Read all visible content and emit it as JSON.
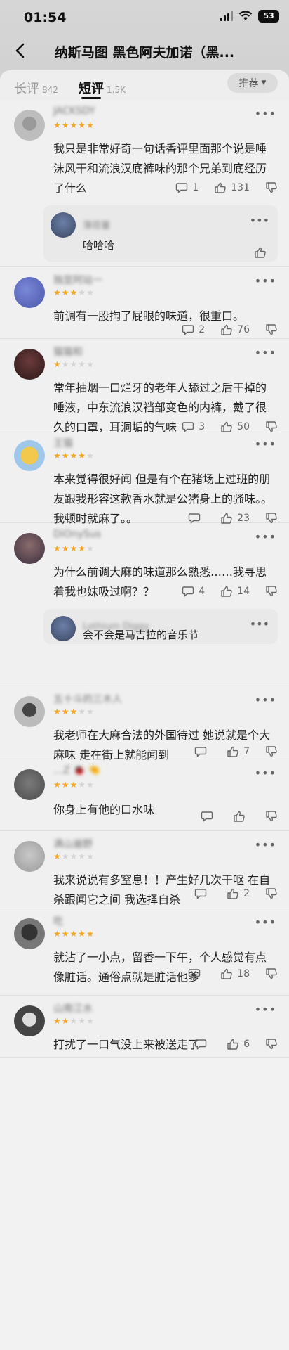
{
  "status_bar": {
    "time": "01:54",
    "battery": "53"
  },
  "nav": {
    "title": "纳斯马图 黑色阿夫加诺（黑..."
  },
  "tabs": {
    "long": {
      "label": "长评",
      "count": "842"
    },
    "short": {
      "label": "短评",
      "count": "1.5K"
    },
    "sort_label": "推荐"
  },
  "colors": {
    "star_on": "#f5a623",
    "star_off": "#d4d4d4",
    "background": "#f0f0f0"
  },
  "comments": [
    {
      "username": "JACKSDY",
      "rating": 5,
      "text": "我只是非常好奇一句话香评里面那个说是唾沫风干和流浪汉底裤味的那个兄弟到底经历了什么",
      "replies_count": "1",
      "likes": "131",
      "reply": {
        "username": "薄荷薯",
        "text": "哈哈哈"
      }
    },
    {
      "username": "独显阿站一",
      "rating": 3,
      "text": "前调有一股掏了屁眼的味道，很重口。",
      "replies_count": "2",
      "likes": "76"
    },
    {
      "username": "猫猫和",
      "rating": 1,
      "text": "常年抽烟一口烂牙的老年人舔过之后干掉的唾液，中东流浪汉裆部变色的内裤，戴了很久的口罩，耳洞垢的气味",
      "replies_count": "3",
      "likes": "50"
    },
    {
      "username": "王猫",
      "rating": 4,
      "text": "本来觉得很好闻 但是有个在猪场上过班的朋友跟我形容这款香水就是公猪身上的骚味。。我顿时就麻了。。",
      "replies_count": "",
      "likes": "23"
    },
    {
      "username": "DiOnySus",
      "rating": 4,
      "text": "为什么前调大麻的味道那么熟悉……我寻思着我也妹吸过啊？？",
      "replies_count": "4",
      "likes": "14",
      "reply": {
        "username": "Lothium Diggy",
        "text": "会不会是马吉拉的音乐节"
      }
    },
    {
      "username": "五十斗的三木人",
      "rating": 3,
      "text": "我老师在大麻合法的外国待过 她说就是个大麻味 走在街上就能闻到",
      "replies_count": "",
      "likes": "7"
    },
    {
      "username": "…Z 🐞 🤏",
      "rating": 3,
      "text": "你身上有他的口水味",
      "replies_count": "",
      "likes": ""
    },
    {
      "username": "满山遍野",
      "rating": 1,
      "text": "我来说说有多窒息！！产生好几次干呕 在自杀跟闻它之间 我选择自杀",
      "replies_count": "",
      "likes": "2"
    },
    {
      "username": "吃",
      "rating": 5,
      "text": "就沾了一小点，留香一下午，个人感觉有点像脏话。通俗点就是脏话他爹",
      "replies_count": "",
      "likes": "18"
    },
    {
      "username": "山南江水",
      "rating": 2,
      "text": "打扰了一口气没上来被送走了",
      "replies_count": "",
      "likes": "6"
    }
  ]
}
